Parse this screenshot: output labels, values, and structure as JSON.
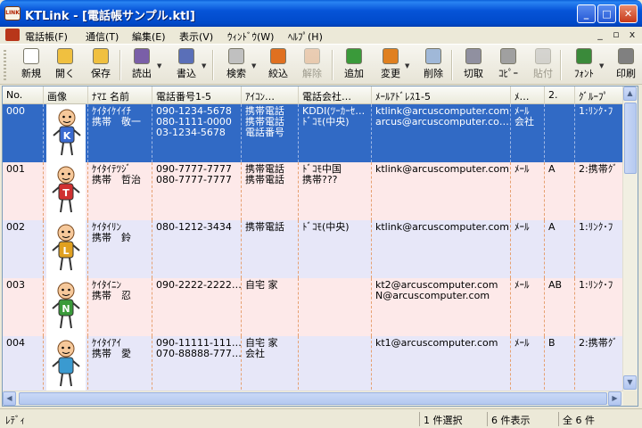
{
  "window": {
    "app_icon_text": "LINK",
    "title": "KTLink - [電話帳サンプル.ktl]"
  },
  "menu": {
    "items": [
      "電話帳(F)",
      "通信(T)",
      "編集(E)",
      "表示(V)",
      "ｳｨﾝﾄﾞｳ(W)",
      "ﾍﾙﾌﾟ(H)"
    ],
    "mdi_controls": [
      "_",
      "▫",
      "x"
    ]
  },
  "toolbar": {
    "buttons": [
      {
        "label": "新規",
        "icon": "new-file-icon",
        "color": "#ffffff",
        "enabled": true
      },
      {
        "label": "開く",
        "icon": "open-folder-icon",
        "color": "#f0c040",
        "enabled": true
      },
      {
        "label": "保存",
        "icon": "save-icon",
        "color": "#f0c040",
        "enabled": true
      },
      {
        "label": "読出",
        "icon": "read-phone-icon",
        "color": "#7a5fa8",
        "enabled": true
      },
      {
        "label": "書込",
        "icon": "write-phone-icon",
        "color": "#5a6fb8",
        "enabled": true
      },
      {
        "label": "検索",
        "icon": "search-icon",
        "color": "#c0c0c0",
        "enabled": true
      },
      {
        "label": "絞込",
        "icon": "filter-icon",
        "color": "#e07020",
        "enabled": true
      },
      {
        "label": "解除",
        "icon": "filter-clear-icon",
        "color": "#e0a070",
        "enabled": false
      },
      {
        "label": "追加",
        "icon": "add-icon",
        "color": "#3a9a3a",
        "enabled": true
      },
      {
        "label": "変更",
        "icon": "edit-icon",
        "color": "#e08020",
        "enabled": true
      },
      {
        "label": "削除",
        "icon": "delete-icon",
        "color": "#a0b8d8",
        "enabled": true
      },
      {
        "label": "切取",
        "icon": "cut-icon",
        "color": "#9090a0",
        "enabled": true
      },
      {
        "label": "ｺﾋﾟｰ",
        "icon": "copy-icon",
        "color": "#a0a0a0",
        "enabled": true
      },
      {
        "label": "貼付",
        "icon": "paste-icon",
        "color": "#b0b0b0",
        "enabled": false
      },
      {
        "label": "ﾌｫﾝﾄ",
        "icon": "font-icon",
        "color": "#3a8a3a",
        "enabled": true
      },
      {
        "label": "印刷",
        "icon": "print-icon",
        "color": "#808080",
        "enabled": true
      }
    ]
  },
  "table": {
    "columns": [
      "No.",
      "画像",
      "ﾅﾏｴ 名前",
      "電話番号1-5",
      "ｱｲｺﾝ…",
      "電話会社…",
      "ﾒｰﾙｱﾄﾞﾚｽ1-5",
      "ﾒ…",
      "2.",
      "ｸﾞﾙｰﾌﾟ"
    ],
    "rows": [
      {
        "no": "000",
        "figure_color": "#3a6ad0",
        "figure_letter": "K",
        "name": [
          "ｹｲﾀｲｹｲｲﾁ",
          "携帯　敬一"
        ],
        "phones": [
          "090-1234-5678",
          "080-1111-0000",
          "03-1234-5678"
        ],
        "icons": [
          "携帯電話",
          "携帯電話",
          "電話番号"
        ],
        "carriers": [
          "KDDI(ﾂｰｶｰｾ…",
          "ﾄﾞｺﾓ(中央)"
        ],
        "emails": [
          "ktlink@arcuscomputer.com",
          "arcus@arcuscomputer.co…"
        ],
        "mailtype": [
          "ﾒｰﾙ",
          "会社"
        ],
        "col2": "",
        "group": "1:ﾘﾝｸ･ﾌ"
      },
      {
        "no": "001",
        "figure_color": "#d03030",
        "figure_letter": "T",
        "name": [
          "ｹｲﾀｲﾃﾂｼﾞ",
          "携帯　哲治"
        ],
        "phones": [
          "090-7777-7777",
          "080-7777-7777"
        ],
        "icons": [
          "携帯電話",
          "携帯電話"
        ],
        "carriers": [
          "ﾄﾞｺﾓ中国",
          "携帯???"
        ],
        "emails": [
          "ktlink@arcuscomputer.com"
        ],
        "mailtype": [
          "ﾒｰﾙ"
        ],
        "col2": "A",
        "group": "2:携帯ｸﾞ"
      },
      {
        "no": "002",
        "figure_color": "#e0a020",
        "figure_letter": "L",
        "name": [
          "ｹｲﾀｲﾘﾝ",
          "携帯　鈴"
        ],
        "phones": [
          "080-1212-3434"
        ],
        "icons": [
          "携帯電話"
        ],
        "carriers": [
          "ﾄﾞｺﾓ(中央)"
        ],
        "emails": [
          "ktlink@arcuscomputer.com"
        ],
        "mailtype": [
          "ﾒｰﾙ"
        ],
        "col2": "A",
        "group": "1:ﾘﾝｸ･ﾌ"
      },
      {
        "no": "003",
        "figure_color": "#3a9a3a",
        "figure_letter": "N",
        "name": [
          "ｹｲﾀｲﾆﾝ",
          "携帯　忍"
        ],
        "phones": [
          "090-2222-2222…"
        ],
        "icons": [
          "自宅 家"
        ],
        "carriers": [],
        "emails": [
          "kt2@arcuscomputer.com",
          "N@arcuscomputer.com"
        ],
        "mailtype": [
          "ﾒｰﾙ"
        ],
        "col2": "AB",
        "group": "1:ﾘﾝｸ･ﾌ"
      },
      {
        "no": "004",
        "figure_color": "#3a9ad0",
        "figure_letter": "",
        "name": [
          "ｹｲﾀｲｱｲ",
          "携帯　愛"
        ],
        "phones": [
          "090-11111-111…",
          "070-88888-777…"
        ],
        "icons": [
          "自宅 家",
          "会社"
        ],
        "carriers": [],
        "emails": [
          "kt1@arcuscomputer.com"
        ],
        "mailtype": [
          "ﾒｰﾙ"
        ],
        "col2": "B",
        "group": "2:携帯ｸﾞ"
      }
    ]
  },
  "status": {
    "ready": "ﾚﾃﾞｨ",
    "selected": "1 件選択",
    "shown": "6 件表示",
    "total": "全 6 件"
  }
}
